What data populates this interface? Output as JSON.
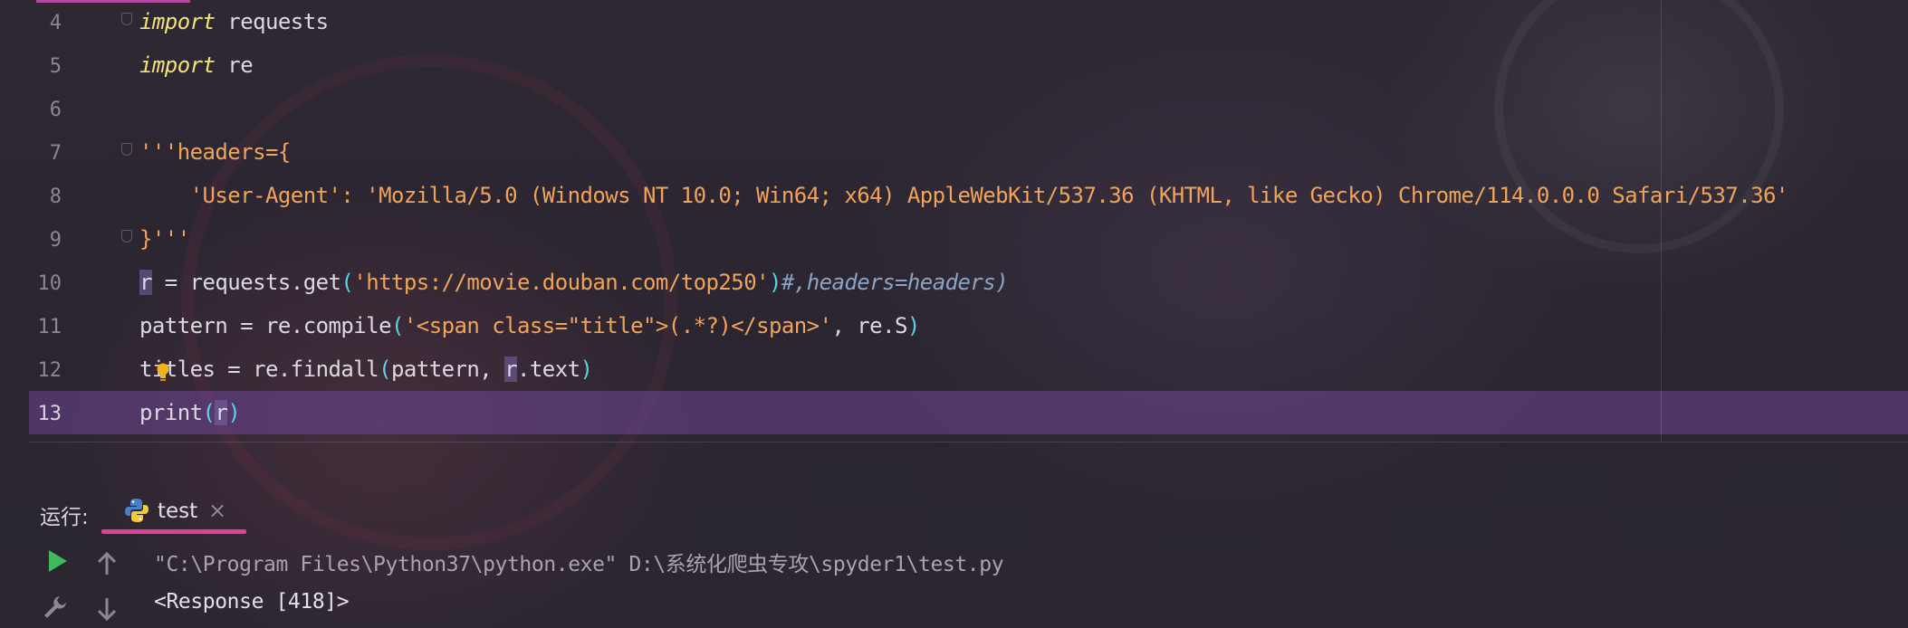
{
  "editor": {
    "lines": [
      {
        "num": "4",
        "parts": [
          {
            "t": "import",
            "c": "kw"
          },
          {
            "t": " requests",
            "c": ""
          }
        ]
      },
      {
        "num": "5",
        "parts": [
          {
            "t": "import",
            "c": "kw"
          },
          {
            "t": " re",
            "c": ""
          }
        ]
      },
      {
        "num": "6",
        "parts": []
      },
      {
        "num": "7",
        "parts": [
          {
            "t": "'''headers={",
            "c": "str"
          }
        ]
      },
      {
        "num": "8",
        "parts": [
          {
            "t": "    'User-Agent': 'Mozilla/5.0 (Windows NT 10.0; Win64; x64) AppleWebKit/537.36 (KHTML, like Gecko) Chrome/114.0.0.0 Safari/537.36'",
            "c": "str"
          }
        ]
      },
      {
        "num": "9",
        "parts": [
          {
            "t": "}'''",
            "c": "str"
          }
        ]
      },
      {
        "num": "10",
        "parts": [
          {
            "t": "r",
            "c": "hl-var"
          },
          {
            "t": " = requests.get",
            "c": ""
          },
          {
            "t": "(",
            "c": "paren"
          },
          {
            "t": "'https://movie.douban.com/top250'",
            "c": "str"
          },
          {
            "t": ")",
            "c": "paren"
          },
          {
            "t": "#,headers=headers)",
            "c": "cmt"
          }
        ]
      },
      {
        "num": "11",
        "parts": [
          {
            "t": "pattern = re.compile",
            "c": ""
          },
          {
            "t": "(",
            "c": "paren"
          },
          {
            "t": "'<span class=\"title\">(.*?)</span>'",
            "c": "str"
          },
          {
            "t": ", re.S",
            "c": ""
          },
          {
            "t": ")",
            "c": "paren"
          }
        ]
      },
      {
        "num": "12",
        "parts": [
          {
            "t": "titles = re.findall",
            "c": ""
          },
          {
            "t": "(",
            "c": "paren"
          },
          {
            "t": "pattern, ",
            "c": ""
          },
          {
            "t": "r",
            "c": "hl-var"
          },
          {
            "t": ".text",
            "c": ""
          },
          {
            "t": ")",
            "c": "paren"
          }
        ]
      },
      {
        "num": "13",
        "parts": [
          {
            "t": "print",
            "c": ""
          },
          {
            "t": "(",
            "c": "paren"
          },
          {
            "t": "r",
            "c": "hl-var"
          },
          {
            "t": ")",
            "c": "paren"
          }
        ],
        "current": true
      }
    ]
  },
  "run_panel": {
    "label": "运行:",
    "tab": {
      "label": "test",
      "icon": "python-icon",
      "close": "×"
    },
    "tools": [
      "run-icon",
      "scroll-up-icon",
      "wrench-icon",
      "scroll-down-icon"
    ],
    "output": [
      {
        "text": "\"C:\\Program Files\\Python37\\python.exe\" D:\\系统化爬虫专攻\\spyder1\\test.py",
        "color": "#a9a3b0"
      },
      {
        "text": "<Response [418]>",
        "color": "#e4e0e8"
      }
    ]
  },
  "colors": {
    "current_line": "#6e4696",
    "keyword": "#f2e27a",
    "string": "#f0a35a",
    "paren": "#59d3e8",
    "comment": "#8ba3c4",
    "tab_underline": "#e0409a"
  }
}
